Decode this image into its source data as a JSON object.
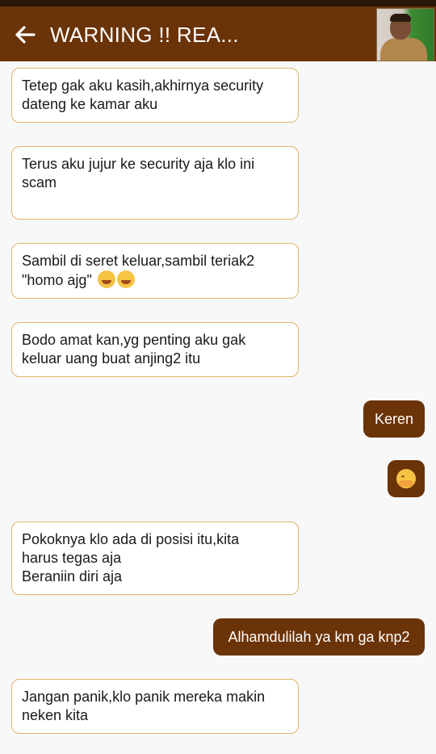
{
  "header": {
    "title": "WARNING !! REA...",
    "back_icon": "arrow-left-icon",
    "avatar": "contact-avatar-photo"
  },
  "colors": {
    "appbar": "#6b3308",
    "outgoing_bubble": "#6b3308",
    "incoming_border": "#e3b56a",
    "background": "#f8f8f8"
  },
  "messages": [
    {
      "direction": "incoming",
      "lines": [
        "Tetep gak aku kasih,akhirnya security",
        "dateng ke kamar aku"
      ]
    },
    {
      "direction": "incoming",
      "lines": [
        "Terus aku jujur ke security  aja klo ini",
        "scam"
      ]
    },
    {
      "direction": "incoming",
      "lines": [
        "Sambil di seret keluar,sambil teriak2",
        "\"homo ajg\""
      ],
      "emojis": [
        "rolling-laughing-emoji",
        "rolling-laughing-emoji"
      ]
    },
    {
      "direction": "incoming",
      "lines": [
        "Bodo amat kan,yg penting aku gak",
        "keluar uang buat anjing2 itu"
      ]
    },
    {
      "direction": "outgoing",
      "text": "Keren"
    },
    {
      "direction": "outgoing",
      "emoji": "hugging-face-emoji"
    },
    {
      "direction": "incoming",
      "lines": [
        "Pokoknya klo ada di posisi itu,kita",
        "harus tegas aja",
        "Beraniin diri aja"
      ]
    },
    {
      "direction": "outgoing",
      "text": "Alhamdulilah ya km ga knp2"
    },
    {
      "direction": "incoming",
      "lines": [
        "Jangan panik,klo panik mereka makin",
        "neken kita"
      ]
    }
  ]
}
